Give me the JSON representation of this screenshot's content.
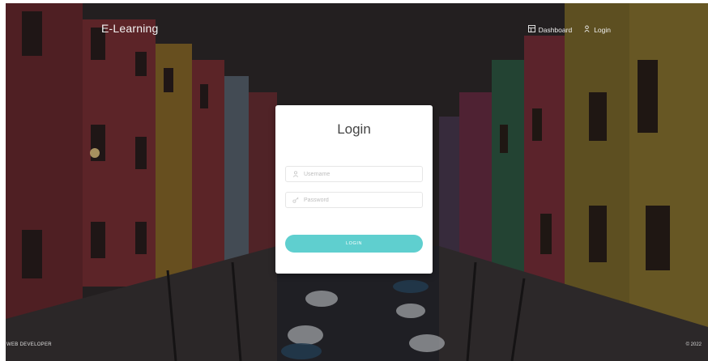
{
  "brand": {
    "name": "E-Learning"
  },
  "nav": {
    "items": [
      {
        "label": "Dashboard",
        "icon": "dashboard-icon"
      },
      {
        "label": "Login",
        "icon": "user-icon"
      }
    ]
  },
  "login_card": {
    "title": "Login",
    "username": {
      "placeholder": "Username",
      "value": "",
      "icon": "user-icon"
    },
    "password": {
      "placeholder": "Password",
      "value": "",
      "icon": "key-icon"
    },
    "submit_label": "LOGIN"
  },
  "footer": {
    "left": "WEB DEVELOPER",
    "right": "© 2022"
  },
  "colors": {
    "accent": "#5fcfcf",
    "card_bg": "#ffffff",
    "text_on_dark": "#f2f2f2"
  }
}
